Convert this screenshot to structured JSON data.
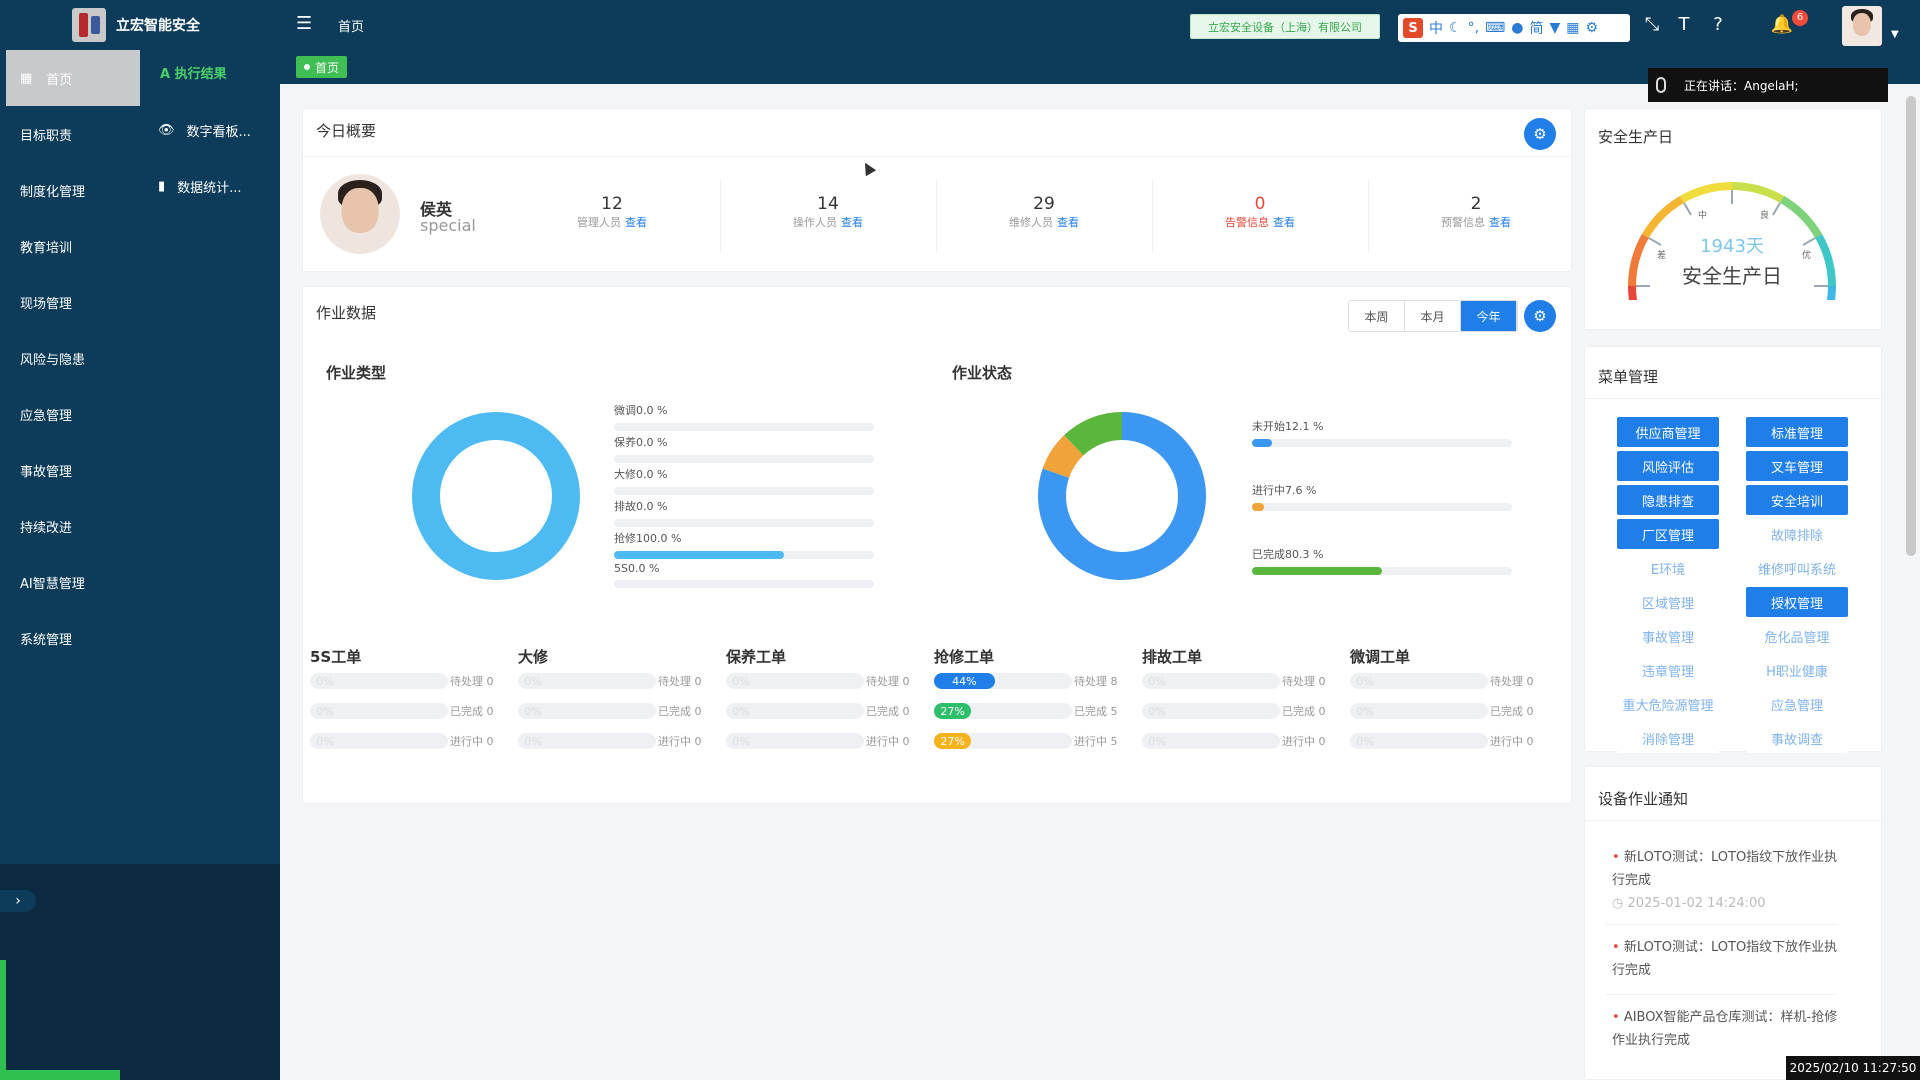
{
  "app": {
    "title": "立宏智能安全",
    "breadcrumb": "首页",
    "tab_home": "首页",
    "company": "立宏安全设备（上海）有限公司",
    "notif_count": "6"
  },
  "ime": {
    "lang": "中",
    "simple": "简"
  },
  "speaking": "正在讲话：AngelaH;",
  "clock": "2025/02/10 11:27:50",
  "sidebar": {
    "items": [
      "首页",
      "目标职责",
      "制度化管理",
      "教育培训",
      "现场管理",
      "风险与隐患",
      "应急管理",
      "事故管理",
      "持续改进",
      "AI智慧管理",
      "系统管理"
    ]
  },
  "subnav": {
    "head": "A 执行结果",
    "items": [
      "数字看板...",
      "数据统计..."
    ]
  },
  "overview": {
    "title": "今日概要",
    "name": "侯英",
    "role": "special",
    "stats": [
      {
        "num": "12",
        "label": "管理人员",
        "link": "查看"
      },
      {
        "num": "14",
        "label": "操作人员",
        "link": "查看"
      },
      {
        "num": "29",
        "label": "维修人员",
        "link": "查看"
      },
      {
        "num": "0",
        "label": "告警信息",
        "link": "查看"
      },
      {
        "num": "2",
        "label": "预警信息",
        "link": "查看"
      }
    ]
  },
  "work": {
    "title": "作业数据",
    "ranges": [
      "本周",
      "本月",
      "今年"
    ],
    "type_title": "作业类型",
    "status_title": "作业状态"
  },
  "chart_data": [
    {
      "type": "pie",
      "title": "作业类型",
      "categories": [
        "微调",
        "保养",
        "大修",
        "排故",
        "抢修",
        "5S"
      ],
      "values": [
        0.0,
        0.0,
        0.0,
        0.0,
        100.0,
        0.0
      ],
      "labels": [
        "微调0.0 %",
        "保养0.0 %",
        "大修0.0 %",
        "排故0.0 %",
        "抢修100.0 %",
        "5S0.0 %"
      ],
      "colors": [
        "#4dbbf2",
        "#4dbbf2",
        "#4dbbf2",
        "#4dbbf2",
        "#4dbbf2",
        "#4dbbf2"
      ]
    },
    {
      "type": "pie",
      "title": "作业状态",
      "categories": [
        "未开始",
        "进行中",
        "已完成"
      ],
      "values": [
        12.1,
        7.6,
        80.3
      ],
      "labels": [
        "未开始12.1 %",
        "进行中7.6 %",
        "已完成80.3 %"
      ],
      "colors": [
        "#5ab73c",
        "#f0a33a",
        "#3c97f2"
      ]
    }
  ],
  "work_orders": [
    {
      "title": "5S工单",
      "rows": [
        {
          "pct": 0,
          "label": "0%",
          "text": "待处理 0"
        },
        {
          "pct": 0,
          "label": "0%",
          "text": "已完成 0"
        },
        {
          "pct": 0,
          "label": "0%",
          "text": "进行中 0"
        }
      ]
    },
    {
      "title": "大修",
      "rows": [
        {
          "pct": 0,
          "label": "0%",
          "text": "待处理 0"
        },
        {
          "pct": 0,
          "label": "0%",
          "text": "已完成 0"
        },
        {
          "pct": 0,
          "label": "0%",
          "text": "进行中 0"
        }
      ]
    },
    {
      "title": "保养工单",
      "rows": [
        {
          "pct": 0,
          "label": "0%",
          "text": "待处理 0"
        },
        {
          "pct": 0,
          "label": "0%",
          "text": "已完成 0"
        },
        {
          "pct": 0,
          "label": "0%",
          "text": "进行中 0"
        }
      ]
    },
    {
      "title": "抢修工单",
      "rows": [
        {
          "pct": 44,
          "label": "44%",
          "text": "待处理 8",
          "color": "#1f7ee8"
        },
        {
          "pct": 27,
          "label": "27%",
          "text": "已完成 5",
          "color": "#2dbf6a"
        },
        {
          "pct": 27,
          "label": "27%",
          "text": "进行中 5",
          "color": "#f5b21a"
        }
      ]
    },
    {
      "title": "排故工单",
      "rows": [
        {
          "pct": 0,
          "label": "0%",
          "text": "待处理 0"
        },
        {
          "pct": 0,
          "label": "0%",
          "text": "已完成 0"
        },
        {
          "pct": 0,
          "label": "0%",
          "text": "进行中 0"
        }
      ]
    },
    {
      "title": "微调工单",
      "rows": [
        {
          "pct": 0,
          "label": "0%",
          "text": "待处理 0"
        },
        {
          "pct": 0,
          "label": "0%",
          "text": "已完成 0"
        },
        {
          "pct": 0,
          "label": "0%",
          "text": "进行中 0"
        }
      ]
    }
  ],
  "safety": {
    "title": "安全生产日",
    "days": "1943天",
    "label": "安全生产日",
    "low": "差",
    "mid": "中",
    "good": "良",
    "excellent": "优"
  },
  "menu": {
    "title": "菜单管理",
    "items": [
      {
        "label": "供应商管理",
        "on": true
      },
      {
        "label": "标准管理",
        "on": true
      },
      {
        "label": "风险评估",
        "on": true
      },
      {
        "label": "叉车管理",
        "on": true
      },
      {
        "label": "隐患排查",
        "on": true
      },
      {
        "label": "安全培训",
        "on": true
      },
      {
        "label": "厂区管理",
        "on": true
      },
      {
        "label": "故障排除",
        "on": false
      },
      {
        "label": "E环境",
        "on": false
      },
      {
        "label": "维修呼叫系统",
        "on": false
      },
      {
        "label": "区域管理",
        "on": false
      },
      {
        "label": "授权管理",
        "on": true
      },
      {
        "label": "事故管理",
        "on": false
      },
      {
        "label": "危化品管理",
        "on": false
      },
      {
        "label": "违章管理",
        "on": false
      },
      {
        "label": "H职业健康",
        "on": false
      },
      {
        "label": "重大危险源管理",
        "on": false
      },
      {
        "label": "应急管理",
        "on": false
      },
      {
        "label": "消除管理",
        "on": false
      },
      {
        "label": "事故调查",
        "on": false
      }
    ]
  },
  "notices": {
    "title": "设备作业通知",
    "items": [
      {
        "text": "新LOTO测试：LOTO指纹下放作业执行完成",
        "time": "2025-01-02 14:24:00"
      },
      {
        "text": "新LOTO测试：LOTO指纹下放作业执行完成",
        "time": ""
      },
      {
        "text": "AIBOX智能产品仓库测试：样机-抢修作业执行完成",
        "time": ""
      }
    ]
  }
}
